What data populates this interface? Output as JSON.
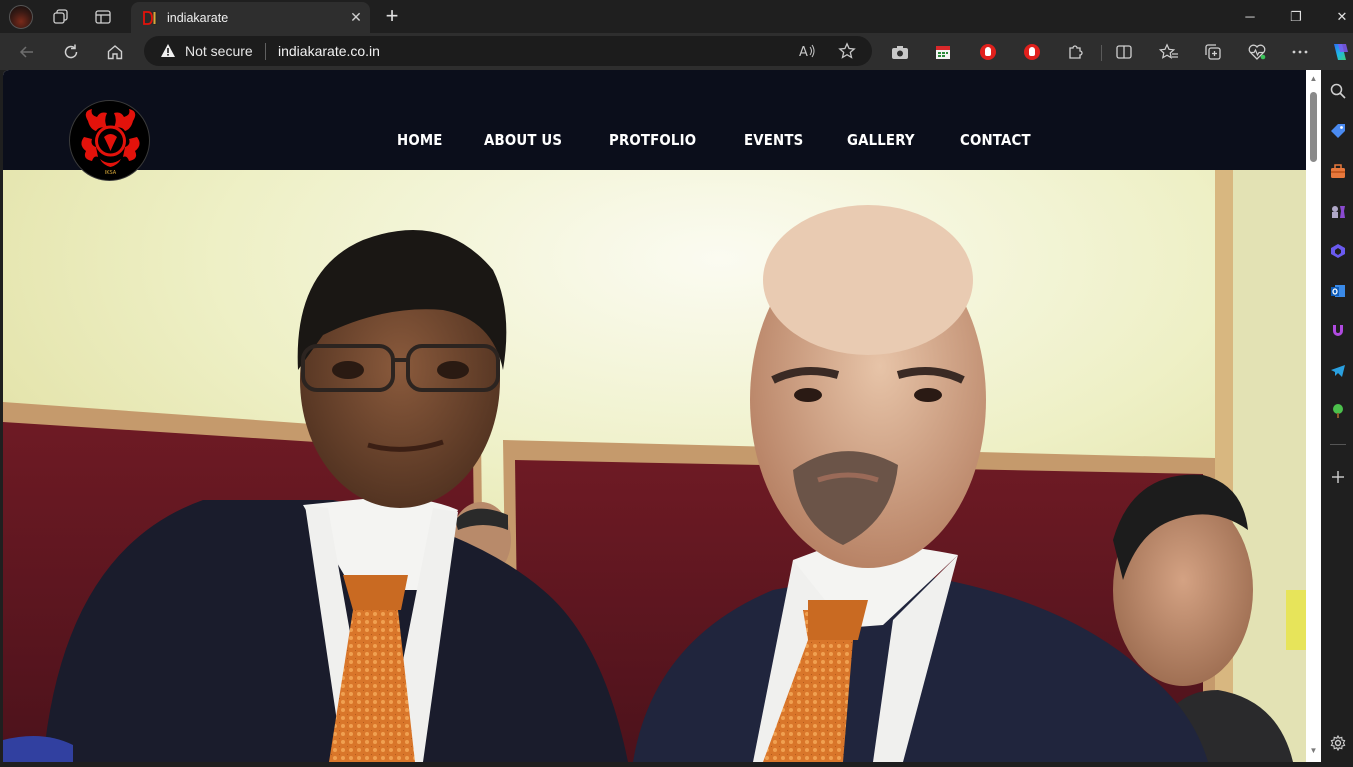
{
  "browser": {
    "tab": {
      "title": "indiakarate",
      "favicon": "indiakarate-favicon"
    },
    "address_bar": {
      "security_label": "Not secure",
      "url": "indiakarate.co.in"
    },
    "window_controls": {
      "minimize": "─",
      "restore": "❐",
      "close": "✕"
    },
    "icons": {
      "profile": "profile-avatar",
      "workspaces": "workspaces-icon",
      "tab_actions": "tab-actions-icon",
      "back": "back-arrow-icon",
      "refresh": "refresh-icon",
      "home": "home-icon",
      "read_aloud": "read-aloud-icon",
      "favorite": "star-icon",
      "screenshot": "camera-icon",
      "extension_calendar": "calendar-extension-icon",
      "extension_adblock_1": "adblock-hand-icon",
      "extension_adblock_2": "adblock-hand-icon",
      "extensions": "puzzle-icon",
      "split_screen": "split-screen-icon",
      "favorites": "favorites-icon",
      "collections": "collections-icon",
      "performance": "heartbeat-icon",
      "more": "more-icon",
      "copilot": "copilot-icon"
    },
    "sidebar_icons": [
      "search-icon",
      "tag-icon",
      "toolbox-icon",
      "chess-icon",
      "copilot-bing-icon",
      "outlook-icon",
      "drop-icon",
      "telegram-icon",
      "tree-icon",
      "add-icon",
      "settings-icon"
    ]
  },
  "site": {
    "nav": [
      "HOME",
      "ABOUT US",
      "PROTFOLIO",
      "EVENTS",
      "GALLERY",
      "CONTACT"
    ],
    "logo_text": "IKSA"
  },
  "colors": {
    "header_bg": "#0b0e1b",
    "browser_chrome": "#1f1f1f",
    "toolbar": "#2e2e2e",
    "adblock_red": "#e0201c",
    "logo_red": "#e3120b"
  }
}
